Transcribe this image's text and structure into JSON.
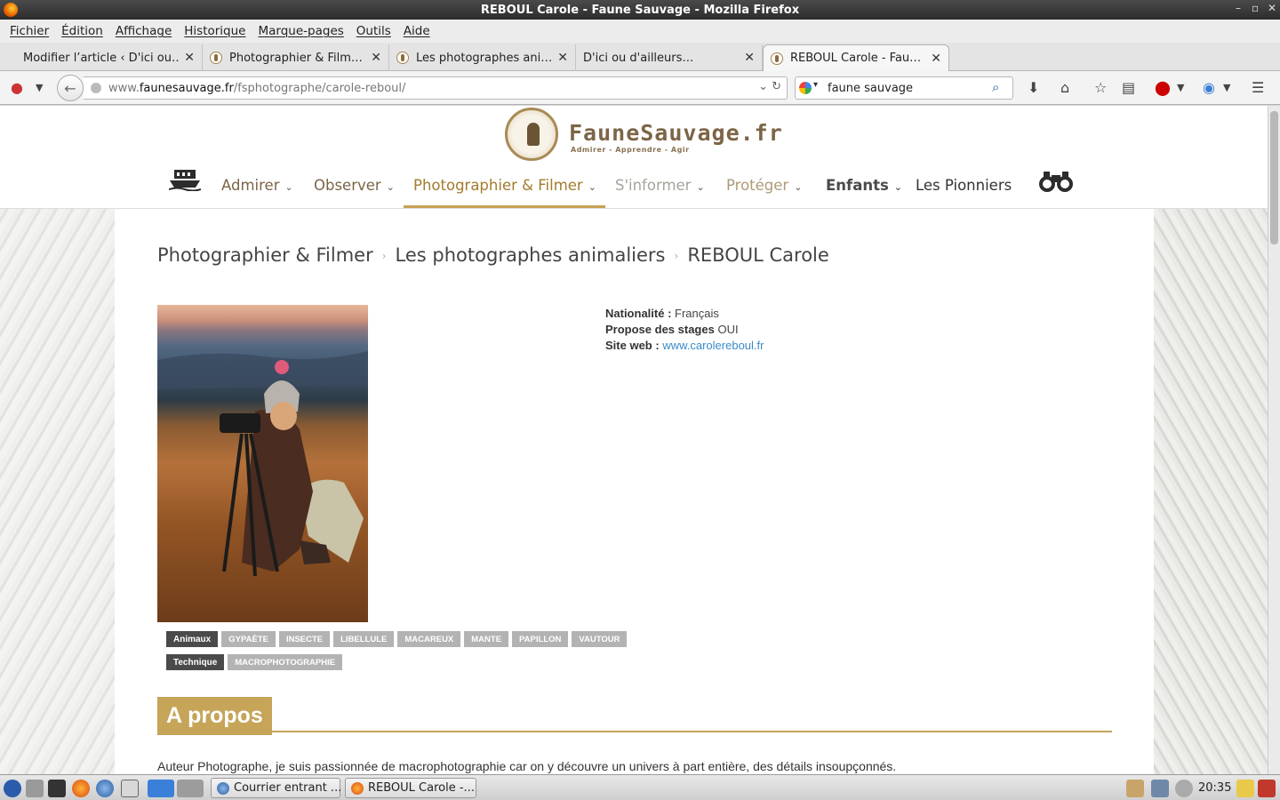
{
  "window": {
    "title": "REBOUL Carole - Faune Sauvage - Mozilla Firefox"
  },
  "menu": [
    "Fichier",
    "Édition",
    "Affichage",
    "Historique",
    "Marque-pages",
    "Outils",
    "Aide"
  ],
  "tabs": [
    {
      "title": "Modifier l’article ‹ D'ici ou…",
      "favicon": false
    },
    {
      "title": "Photographier & Film…",
      "favicon": true
    },
    {
      "title": "Les photographes ani…",
      "favicon": true
    },
    {
      "title": "D'ici ou d'ailleurs…",
      "favicon": false
    },
    {
      "title": "REBOUL Carole - Fau…",
      "favicon": true
    }
  ],
  "url": {
    "prefix": "www.",
    "host": "faunesauvage.fr",
    "path": "/fsphotographe/carole-reboul/"
  },
  "search": {
    "value": "faune sauvage"
  },
  "site": {
    "logo_text": "FauneSauvage.fr",
    "tagline": "Admirer - Apprendre - Agir",
    "nav": [
      {
        "label": "Admirer",
        "color": "#7c6547",
        "chevron": true
      },
      {
        "label": "Observer",
        "color": "#7c6547",
        "chevron": true
      },
      {
        "label": "Photographier & Filmer",
        "color": "#a37b2c",
        "chevron": true
      },
      {
        "label": "S'informer",
        "color": "#a6a39c",
        "chevron": true
      },
      {
        "label": "Protéger",
        "color": "#ad9a78",
        "chevron": true
      },
      {
        "label": "Enfants",
        "color": "#4a4a4a",
        "chevron": true
      },
      {
        "label": "Les Pionniers",
        "color": "#333333",
        "chevron": false
      }
    ]
  },
  "breadcrumb": [
    "Photographier & Filmer",
    "Les photographes animaliers",
    "REBOUL Carole"
  ],
  "profile": {
    "nationality_label": "Nationalité :",
    "nationality": "Français",
    "stages_label": "Propose des stages",
    "stages": "OUI",
    "website_label": "Site web :",
    "website": "www.carolereboul.fr"
  },
  "tags": {
    "animaux_label": "Animaux",
    "animaux": [
      "GYPAÈTE",
      "INSECTE",
      "LIBELLULE",
      "MACAREUX",
      "MANTE",
      "PAPILLON",
      "VAUTOUR"
    ],
    "technique_label": "Technique",
    "technique": [
      "MACROPHOTOGRAPHIE"
    ]
  },
  "about": {
    "heading": "A propos",
    "text": "Auteur Photographe, je suis passionnée de macrophotographie car on y découvre un univers à part entière, des détails insoupçonnés."
  },
  "taskbar": {
    "tasks": [
      "Courrier entrant ...",
      "REBOUL Carole -..."
    ],
    "clock": "20:35"
  }
}
